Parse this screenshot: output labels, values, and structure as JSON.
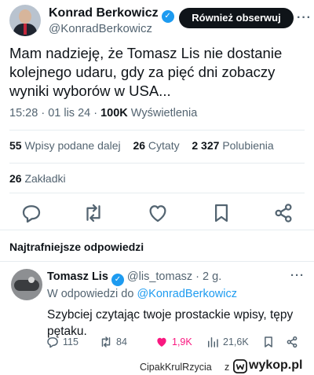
{
  "tweet": {
    "author_name": "Konrad Berkowicz",
    "author_handle": "@KonradBerkowicz",
    "follow_label": "Również obserwuj",
    "text": "Mam nadzieję, że Tomasz Lis nie dostanie kolejnego udaru, gdy za pięć dni zobaczy wyniki wyborów w USA...",
    "time": "15:28",
    "date": "01 lis 24",
    "views_count": "100K",
    "views_label": "Wyświetlenia",
    "reposts_count": "55",
    "reposts_label": "Wpisy podane dalej",
    "quotes_count": "26",
    "quotes_label": "Cytaty",
    "likes_count": "2 327",
    "likes_label": "Polubienia",
    "bookmarks_count": "26",
    "bookmarks_label": "Zakładki"
  },
  "replies_section": {
    "title": "Najtrafniejsze odpowiedzi"
  },
  "reply": {
    "author_name": "Tomasz Lis",
    "author_handle": "@lis_tomasz",
    "age": "2 g.",
    "reply_to_label": "W odpowiedzi do",
    "reply_to_handle": "@KonradBerkowicz",
    "text": "Szybciej czytając twoje prostackie wpisy, tępy pętaku.",
    "reply_count": "115",
    "repost_count": "84",
    "like_count": "1,9K",
    "view_count": "21,6K"
  },
  "watermark": {
    "user": "CipakKrulRzycia",
    "separator": "z",
    "site": "wykop.pl"
  },
  "colors": {
    "accent": "#1d9bf0",
    "like": "#f91880",
    "text_primary": "#0f1419",
    "text_secondary": "#536471"
  },
  "icons": {
    "top": [
      "verified-badge-icon",
      "more-icon"
    ],
    "actions": [
      "reply-icon",
      "repost-icon",
      "like-icon",
      "bookmark-icon",
      "share-icon"
    ],
    "reply_actions": [
      "reply-icon",
      "repost-icon",
      "like-icon",
      "views-icon",
      "bookmark-icon",
      "share-icon"
    ]
  }
}
